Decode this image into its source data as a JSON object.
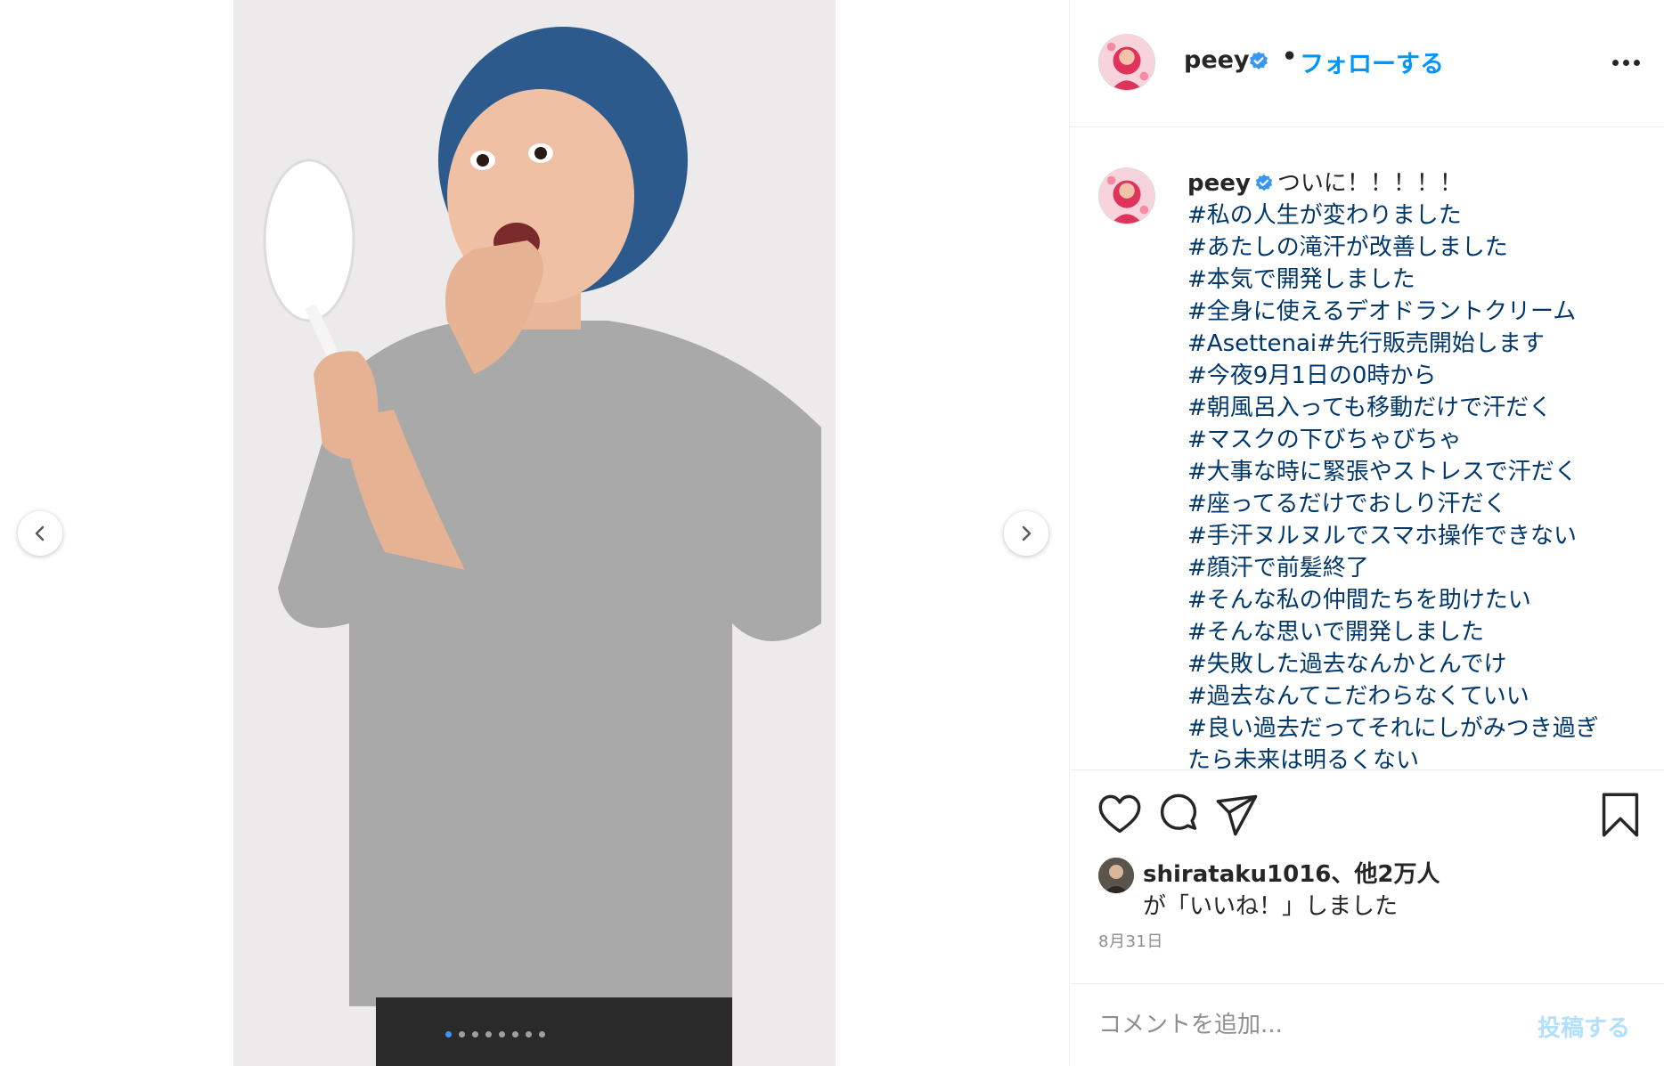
{
  "post": {
    "username": "peey",
    "separator": "•",
    "follow_label": "フォローする",
    "more_icon": "more-horizontal-icon",
    "verified_icon": "verified-badge-icon"
  },
  "caption": {
    "username": "peey",
    "first_line": "ついに！！！！！",
    "hashtags": [
      "#私の人生が変わりました",
      "#あたしの滝汗が改善しました",
      "#本気で開発しました",
      "#全身に使えるデオドラントクリーム",
      "#Asettenai#先行販売開始します",
      "#今夜9月1日の0時から",
      "#朝風呂入っても移動だけで汗だく",
      "#マスクの下びちゃびちゃ",
      "#大事な時に緊張やストレスで汗だく",
      "#座ってるだけでおしり汗だく",
      "#手汗ヌルヌルでスマホ操作できない",
      "#顔汗で前髪終了",
      "#そんな私の仲間たちを助けたい",
      "#そんな思いで開発しました",
      "#失敗した過去なんかとんでけ",
      "#過去なんてこだわらなくていい",
      "#良い過去だってそれにしがみつき過ぎ",
      "たら未来は明るくない"
    ]
  },
  "likes": {
    "line1": "shirataku1016、他2万人",
    "line2": "が「いいね！」しました"
  },
  "date": "8月31日",
  "comment": {
    "placeholder": "コメントを追加...",
    "post_label": "投稿する"
  },
  "carousel": {
    "total": 8,
    "active_index": 0
  },
  "colors": {
    "link_blue": "#0095f6",
    "hashtag": "#00376b",
    "post_disabled": "#b2dffc",
    "carousel_active": "#3897f0"
  }
}
